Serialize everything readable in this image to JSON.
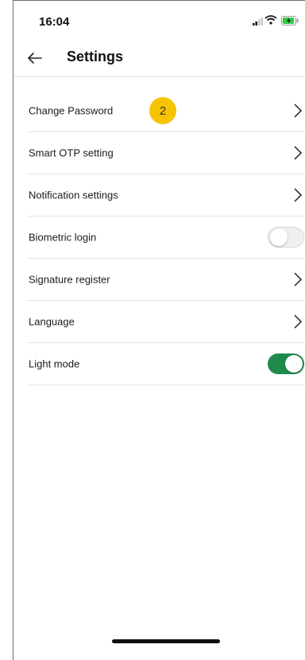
{
  "status_bar": {
    "time": "16:04",
    "icons": [
      "cellular-signal-icon",
      "wifi-icon",
      "battery-charging-icon"
    ]
  },
  "header": {
    "title": "Settings",
    "back_icon": "arrow-left-icon"
  },
  "items": [
    {
      "label": "Change Password",
      "control": "chevron",
      "badge": "2"
    },
    {
      "label": "Smart OTP setting",
      "control": "chevron"
    },
    {
      "label": "Notification settings",
      "control": "chevron"
    },
    {
      "label": "Biometric login",
      "control": "toggle",
      "on": false
    },
    {
      "label": "Signature register",
      "control": "chevron"
    },
    {
      "label": "Language",
      "control": "chevron"
    },
    {
      "label": "Light mode",
      "control": "toggle",
      "on": true
    }
  ],
  "colors": {
    "badge": "#f6c400",
    "toggle_on": "#1f8a4c",
    "toggle_off": "#efefef"
  }
}
